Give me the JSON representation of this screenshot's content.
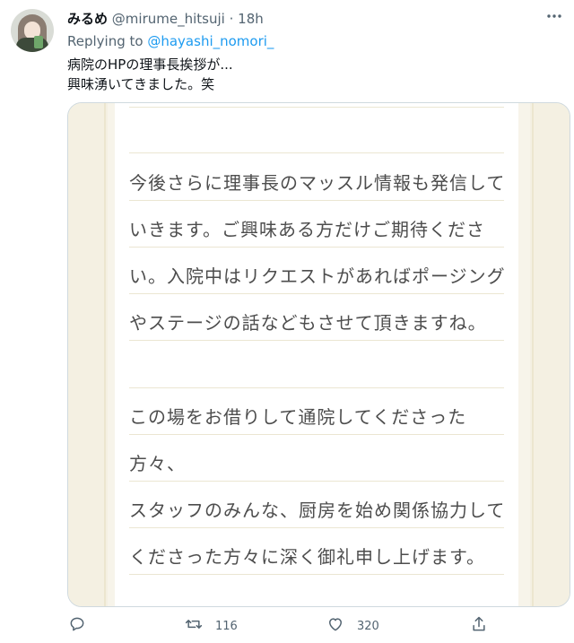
{
  "tweet": {
    "display_name": "みるめ",
    "handle": "@mirume_hitsuji",
    "separator": "·",
    "time": "18h",
    "replying_prefix": "Replying to",
    "replying_to": "@hayashi_nomori_",
    "text_lines": [
      "病院のHPの理事長挨拶が...",
      "興味湧いてきました。笑"
    ]
  },
  "image_text": {
    "lines": [
      "今後さらに理事長のマッスル情報も発信して",
      "いきます。ご興味ある方だけご期待くださ",
      "い。入院中はリクエストがあればポージング",
      "やステージの話などもさせて頂きますね。",
      "この場をお借りして通院してくださった",
      "方々、",
      "スタッフのみんな、厨房を始め関係協力して",
      "くださった方々に深く御礼申し上げます。"
    ]
  },
  "actions": {
    "reply_count": "",
    "retweet_count": "116",
    "like_count": "320"
  },
  "icons": {
    "reply": "reply-icon",
    "retweet": "retweet-icon",
    "like": "heart-icon",
    "share": "share-icon",
    "more": "more-icon"
  },
  "colors": {
    "link": "#1d9bf0",
    "secondary_text": "#536471"
  }
}
